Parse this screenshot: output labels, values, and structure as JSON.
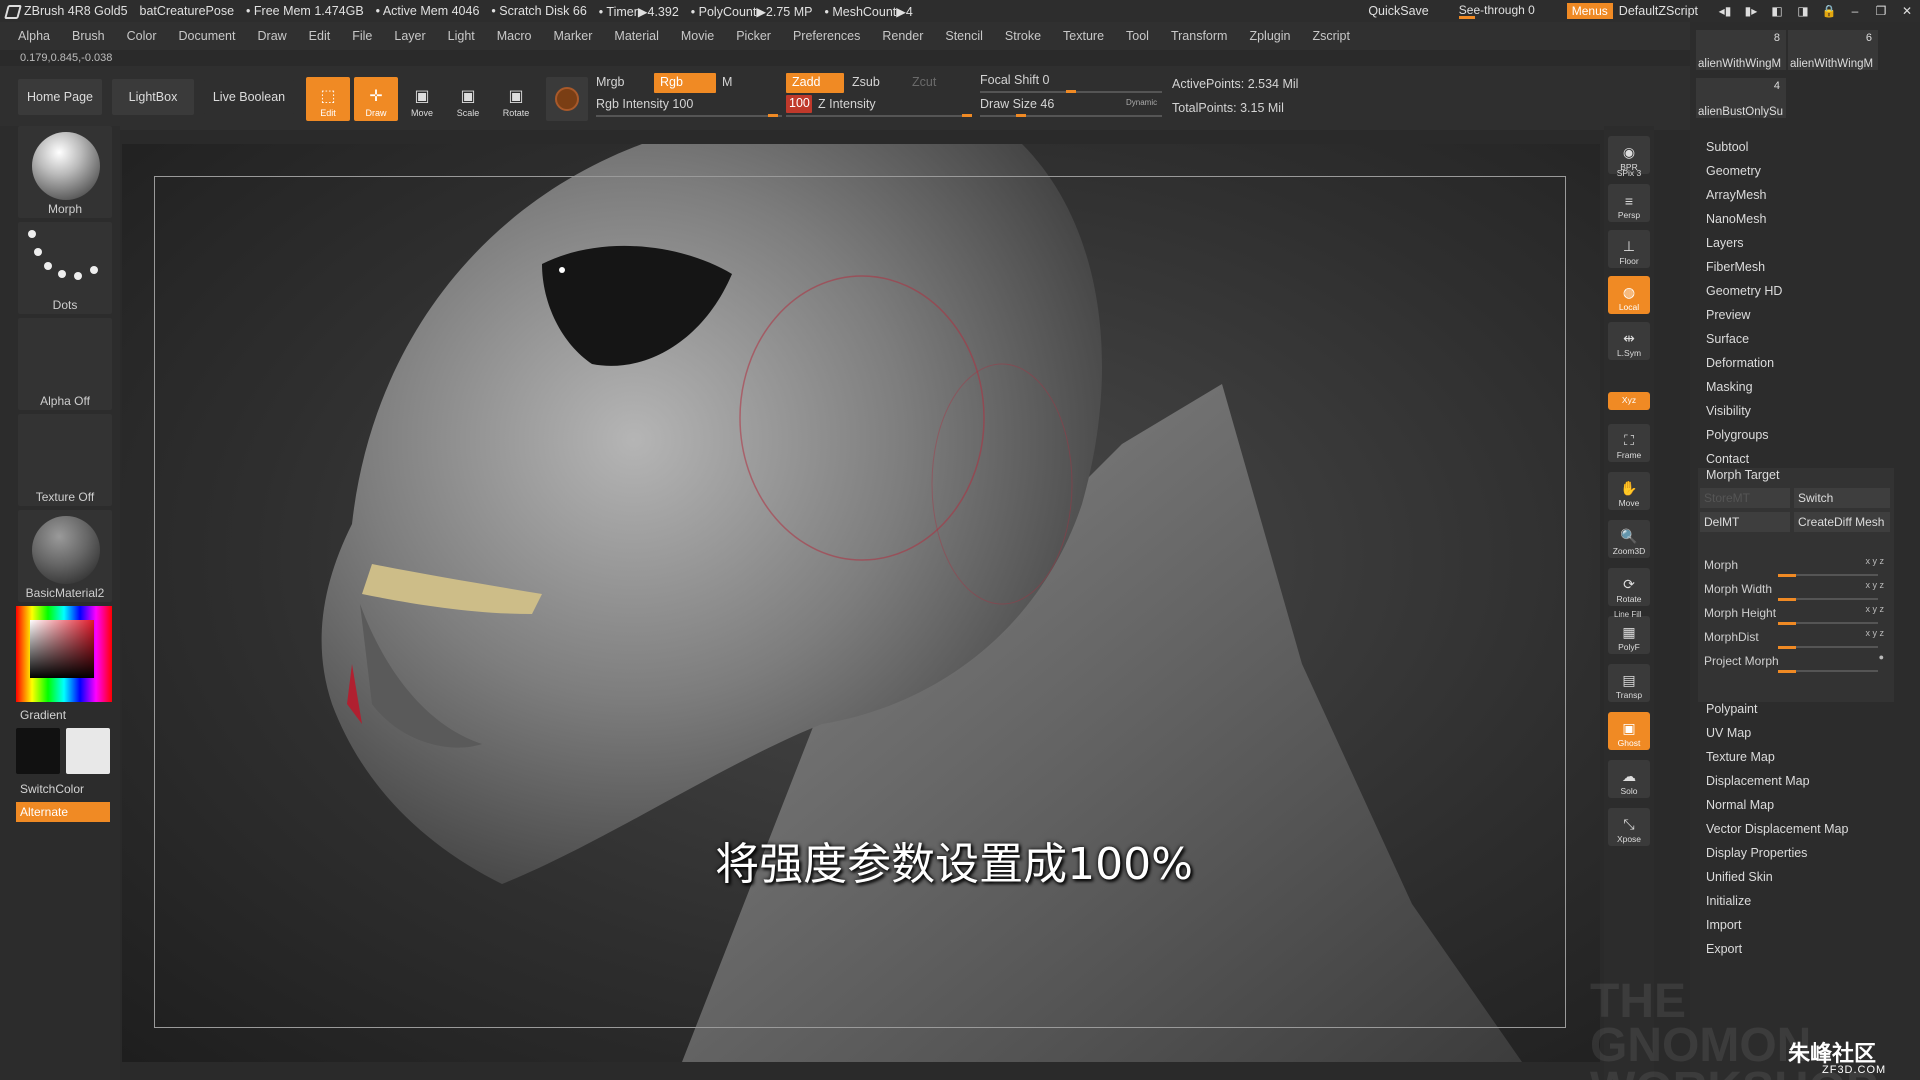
{
  "title": {
    "app": "ZBrush 4R8 Gold5",
    "project": "batCreaturePose",
    "free_mem": "• Free Mem 1.474GB",
    "active_mem": "• Active Mem 4046",
    "scratch": "• Scratch Disk 66",
    "timer": "• Timer▶4.392",
    "polycount": "• PolyCount▶2.75 MP",
    "meshcount": "• MeshCount▶4",
    "quicksave": "QuickSave",
    "see_through": "See-through  0",
    "menus": "Menus",
    "default_zscript": "DefaultZScript"
  },
  "menus": [
    "Alpha",
    "Brush",
    "Color",
    "Document",
    "Draw",
    "Edit",
    "File",
    "Layer",
    "Light",
    "Macro",
    "Marker",
    "Material",
    "Movie",
    "Picker",
    "Preferences",
    "Render",
    "Stencil",
    "Stroke",
    "Texture",
    "Tool",
    "Transform",
    "Zplugin",
    "Zscript"
  ],
  "coords": "0.179,0.845,-0.038",
  "shelf": {
    "home_page": "Home Page",
    "lightbox": "LightBox",
    "live_boolean": "Live Boolean",
    "edit": "Edit",
    "draw": "Draw",
    "move": "Move",
    "scale": "Scale",
    "rotate": "Rotate",
    "mrgb": "Mrgb",
    "rgb": "Rgb",
    "m": "M",
    "zadd": "Zadd",
    "zsub": "Zsub",
    "zcut": "Zcut",
    "rgb_intensity": "Rgb Intensity 100",
    "z_intensity_value": "100",
    "z_intensity": "Z Intensity",
    "focal_shift": "Focal Shift 0",
    "draw_size": "Draw Size 46",
    "dynamic": "Dynamic",
    "active_points": "ActivePoints: 2.534 Mil",
    "total_points": "TotalPoints: 3.15 Mil"
  },
  "left": {
    "morph": "Morph",
    "dots": "Dots",
    "alpha_off": "Alpha Off",
    "texture_off": "Texture Off",
    "material": "BasicMaterial2",
    "gradient": "Gradient",
    "switch_color": "SwitchColor",
    "alternate": "Alternate"
  },
  "dock": {
    "bpr": "BPR",
    "spix": "SPix 3",
    "persp": "Persp",
    "floor": "Floor",
    "local": "Local",
    "lsym": "L.Sym",
    "xyz": "Xyz",
    "frame": "Frame",
    "move": "Move",
    "zoom3d": "Zoom3D",
    "rotate": "Rotate",
    "line_fill": "Line Fill",
    "polyf": "PolyF",
    "transp": "Transp",
    "ghost": "Ghost",
    "solo": "Solo",
    "xpose": "Xpose"
  },
  "right": {
    "thumbs": [
      {
        "name": "alienWithWingM",
        "count": "8"
      },
      {
        "name": "alienWithWingM",
        "count": "6"
      },
      {
        "name": "alienBustOnlySu",
        "count": "4"
      }
    ],
    "items_top": [
      "Subtool",
      "Geometry",
      "ArrayMesh",
      "NanoMesh",
      "Layers",
      "FiberMesh",
      "Geometry HD",
      "Preview",
      "Surface",
      "Deformation",
      "Masking",
      "Visibility",
      "Polygroups",
      "Contact"
    ],
    "morph_target": {
      "title": "Morph Target",
      "store_mt": "StoreMT",
      "switch": "Switch",
      "del_mt": "DelMT",
      "create_diff": "CreateDiff Mesh",
      "morph": "Morph",
      "morph_width": "Morph Width",
      "morph_height": "Morph Height",
      "morph_dist": "MorphDist",
      "project_morph": "Project Morph"
    },
    "items_bottom": [
      "Polypaint",
      "UV Map",
      "Texture Map",
      "Displacement Map",
      "Normal Map",
      "Vector Displacement Map",
      "Display Properties",
      "Unified Skin",
      "Initialize",
      "Import",
      "Export"
    ]
  },
  "subtitle": "将强度参数设置成100%",
  "watermark": "THE GNOMON WORKSHOP",
  "site_logo": "朱峰社区",
  "site_url": "ZF3D.COM"
}
